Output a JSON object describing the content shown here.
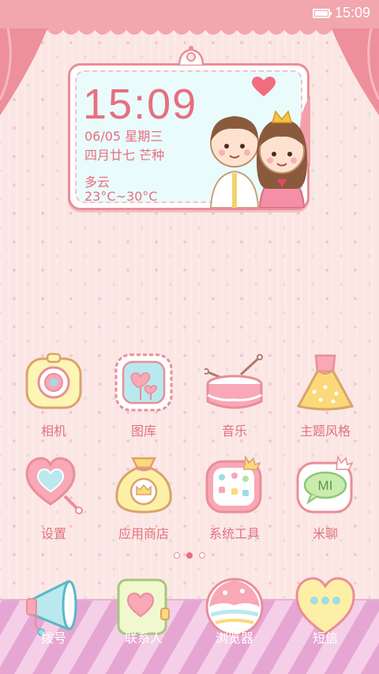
{
  "status_bar": {
    "time": "15:09",
    "battery_icon": "battery-icon"
  },
  "widget": {
    "time": "15:09",
    "date": "06/05",
    "weekday": "星期三",
    "lunar": "四月廿七",
    "solar_term": "芒种",
    "weather": "多云",
    "temperature": "23°C~30°C"
  },
  "apps_row1": [
    {
      "label": "相机",
      "icon": "camera-icon"
    },
    {
      "label": "图库",
      "icon": "gallery-icon"
    },
    {
      "label": "音乐",
      "icon": "music-drum-icon"
    },
    {
      "label": "主题风格",
      "icon": "dress-theme-icon"
    }
  ],
  "apps_row2": [
    {
      "label": "设置",
      "icon": "heart-settings-icon"
    },
    {
      "label": "应用商店",
      "icon": "app-store-bag-icon"
    },
    {
      "label": "系统工具",
      "icon": "tools-folder-icon"
    },
    {
      "label": "米聊",
      "icon": "mi-chat-icon"
    }
  ],
  "page_indicator": {
    "count": 3,
    "active": 2
  },
  "dock": [
    {
      "label": "拨号",
      "icon": "megaphone-phone-icon"
    },
    {
      "label": "联系人",
      "icon": "contacts-book-icon"
    },
    {
      "label": "浏览器",
      "icon": "browser-ball-icon"
    },
    {
      "label": "短信",
      "icon": "heart-message-icon"
    }
  ],
  "colors": {
    "accent": "#e76f7e",
    "statusbar": "#f2a6ae",
    "background": "#fbe6e4",
    "dock_stripe": "#e6a6d3"
  }
}
